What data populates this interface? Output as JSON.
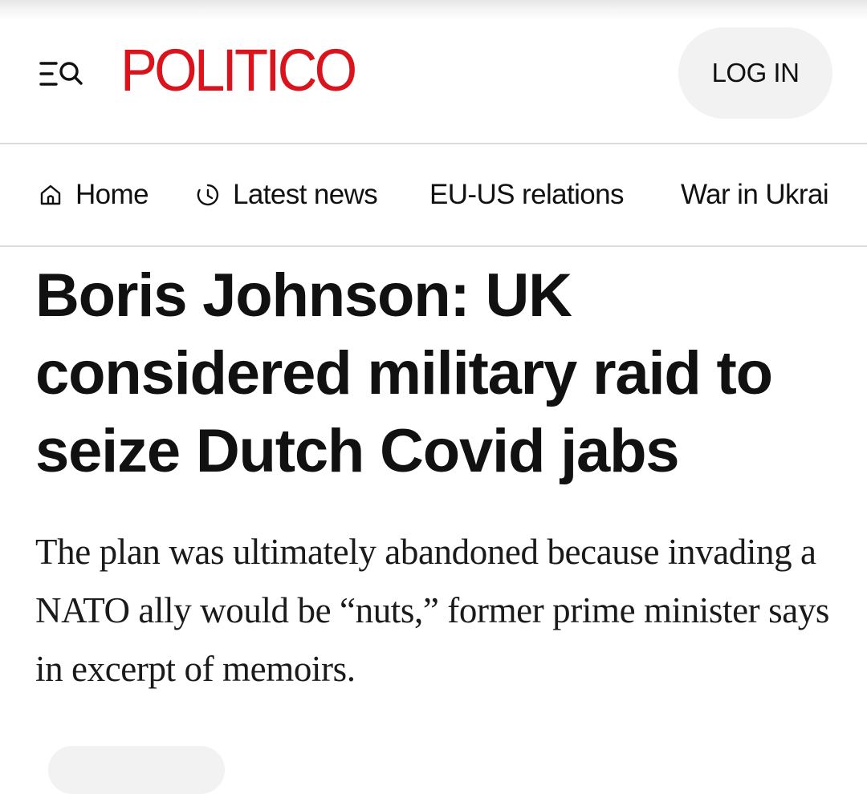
{
  "header": {
    "logo_text": "POLITICO",
    "login_label": "LOG IN",
    "brand_color": "#d9141c",
    "menu_icon": "menu-search-icon"
  },
  "nav": {
    "items": [
      {
        "label": "Home",
        "icon": "home-icon"
      },
      {
        "label": "Latest news",
        "icon": "clock-icon"
      },
      {
        "label": "EU-US relations"
      },
      {
        "label": "War in Ukrai"
      }
    ]
  },
  "article": {
    "headline": "Boris Johnson: UK considered military raid to seize Dutch Covid jabs",
    "dek": "The plan was ultimately abandoned because invading a NATO ally would be “nuts,” former prime minister says in excerpt of memoirs."
  }
}
